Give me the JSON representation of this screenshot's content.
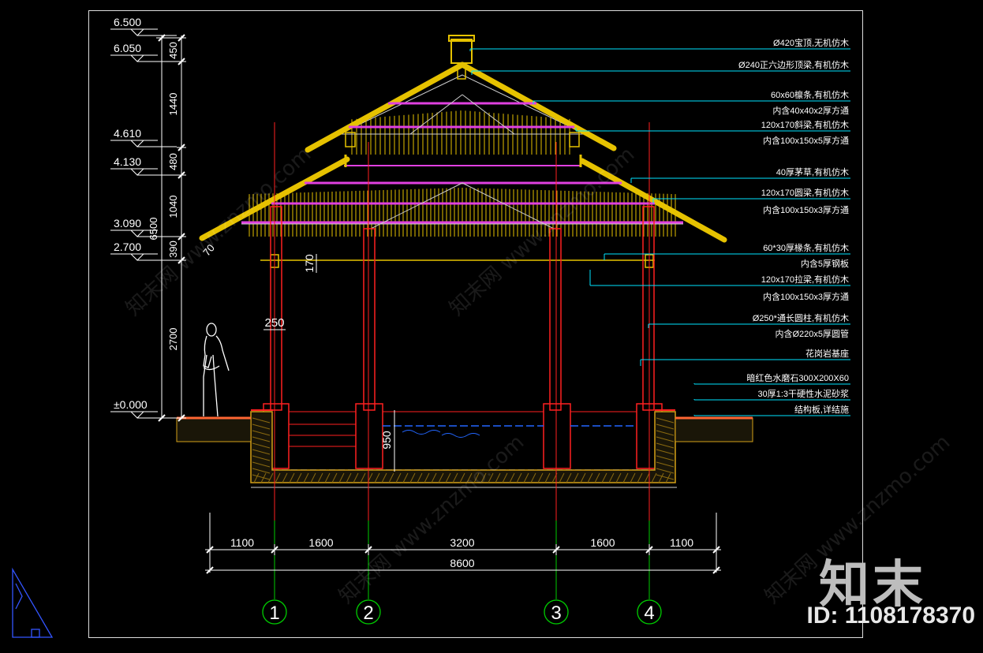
{
  "elevations": [
    "6.500",
    "6.050",
    "4.610",
    "4.130",
    "3.090",
    "2.700",
    "±0.000"
  ],
  "vertical_dims": {
    "total": "6500",
    "segments": [
      "450",
      "1440",
      "480",
      "1040",
      "390",
      "2700"
    ],
    "other": [
      "170",
      "250",
      "950",
      "70"
    ]
  },
  "horizontal_dims": {
    "segments": [
      "1100",
      "1600",
      "3200",
      "1600",
      "1100"
    ],
    "total": "8600"
  },
  "axes": [
    "1",
    "2",
    "3",
    "4"
  ],
  "annotations": [
    "Ø420宝顶,无机仿木",
    "Ø240正六边形顶梁,有机仿木",
    "60x60檩条,有机仿木",
    "内含40x40x2厚方通",
    "120x170斜梁,有机仿木",
    "内含100x150x5厚方通",
    "40厚茅草,有机仿木",
    "120x170圆梁,有机仿木",
    "内含100x150x3厚方通",
    "60*30厚椽条,有机仿木",
    "内含5厚钢板",
    "120x170拉梁,有机仿木",
    "内含100x150x3厚方通",
    "Ø250*通长圆柱,有机仿木",
    "内含Ø220x5厚圆管",
    "花岗岩基座",
    "暗红色水磨石300X200X60",
    "30厚1:3干硬性水泥砂浆",
    "结构板,详结施"
  ],
  "watermark": "知末网 www.znzmo.com",
  "brand": "知末",
  "id_label": "ID: 1108178370",
  "colors": {
    "background": "#000000",
    "dimension": "#ffffff",
    "axis_line": "#00cc00",
    "column": "#ff2020",
    "thatch": "#e6c200",
    "beam": "#e040e0",
    "leader": "#00e5ff",
    "ground": "#d4a017"
  }
}
